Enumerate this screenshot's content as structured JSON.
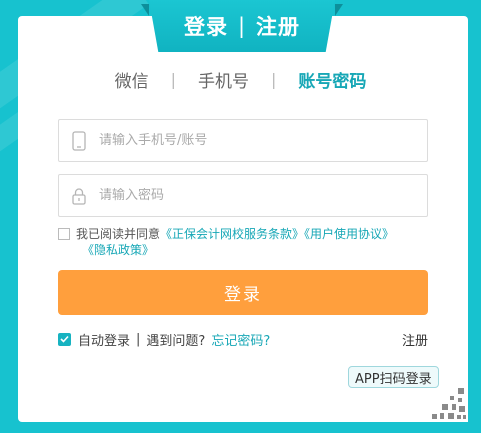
{
  "header": {
    "login_label": "登录",
    "separator": "|",
    "register_label": "注册"
  },
  "tabs": [
    {
      "label": "微信",
      "active": false
    },
    {
      "label": "手机号",
      "active": false
    },
    {
      "label": "账号密码",
      "active": true
    }
  ],
  "tab_separator": "|",
  "form": {
    "account_placeholder": "请输入手机号/账号",
    "account_value": "",
    "password_placeholder": "请输入密码",
    "password_value": ""
  },
  "agreement": {
    "prefix": "我已阅读并同意",
    "terms_link": "《正保会计网校服务条款》",
    "user_agreement_link": "《用户使用协议》",
    "privacy_link": "《隐私政策》",
    "checked": false
  },
  "login_button": "登录",
  "options": {
    "auto_login_label": "自动登录",
    "auto_login_checked": true,
    "separator": "|",
    "problem_label": "遇到问题?",
    "forgot_label": "忘记密码?",
    "register_label": "注册"
  },
  "qr_tip": "APP扫码登录",
  "colors": {
    "background": "#17c2cf",
    "accent": "#17a7b6",
    "login_button": "#ff9f3d"
  },
  "icons": {
    "phone": "phone-icon",
    "lock": "lock-icon",
    "check": "check-icon",
    "qr": "qr-code-icon"
  }
}
